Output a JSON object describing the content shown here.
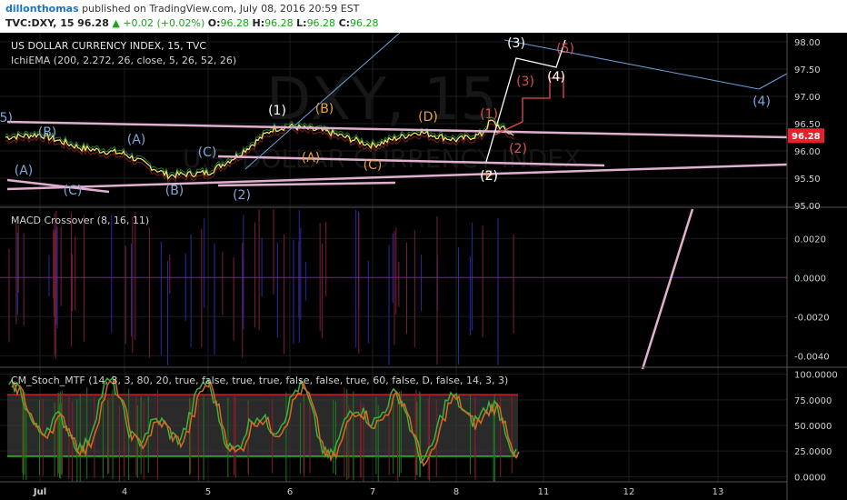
{
  "header": {
    "author": "dillonthomas",
    "published": "published on TradingView.com, July 08, 2016 20:59 EST",
    "symbol": "TVC:DXY, 15",
    "price": "96.28",
    "change": "+0.02 (+0.02%)",
    "o_label": "O:",
    "o_val": "96.28",
    "h_label": "H:",
    "h_val": "96.28",
    "l_label": "L:",
    "l_val": "96.28",
    "c_label": "C:",
    "c_val": "96.28"
  },
  "colors": {
    "background": "#000000",
    "grid": "#1c1c1c",
    "price_tag": "#e8202a",
    "macd_zero": "#7a1f7a",
    "stoch_upper": "#cc2222",
    "stoch_lower": "#22cc22",
    "trendline": "#e0b0d0",
    "channel": "#6aa0d8"
  },
  "main": {
    "title": "US DOLLAR CURRENCY INDEX, 15, TVC",
    "indicator": "IchiEMA (200, 2.272, 26, close, 5, 26, 52, 26)",
    "watermark": "DXY, 15",
    "watermark_sub": "U.S. DOLLAR CURRENCY INDEX",
    "last_price": "96.28",
    "wave_labels": [
      {
        "t": "(5)",
        "c": "#7fa7d8"
      },
      {
        "t": "(B)",
        "c": "#7fa7d8"
      },
      {
        "t": "(A)",
        "c": "#7fa7d8"
      },
      {
        "t": "(A)",
        "c": "#7fa7d8"
      },
      {
        "t": "(C)",
        "c": "#7fa7d8"
      },
      {
        "t": "(B)",
        "c": "#7fa7d8"
      },
      {
        "t": "(C)",
        "c": "#7fa7d8"
      },
      {
        "t": "(2)",
        "c": "#7fa7d8"
      },
      {
        "t": "(1)",
        "c": "#ffffff"
      },
      {
        "t": "(B)",
        "c": "#e8a040"
      },
      {
        "t": "(A)",
        "c": "#e8a040"
      },
      {
        "t": "(C)",
        "c": "#e8a040"
      },
      {
        "t": "(D)",
        "c": "#e8a040"
      },
      {
        "t": "(E)",
        "c": "#e8a040"
      },
      {
        "t": "(1)",
        "c": "#e05050"
      },
      {
        "t": "(2)",
        "c": "#e05050"
      },
      {
        "t": "(3)",
        "c": "#e05050"
      },
      {
        "t": "(4)",
        "c": "#e05050"
      },
      {
        "t": "(5)",
        "c": "#e05050"
      },
      {
        "t": "(2)",
        "c": "#ffffff"
      },
      {
        "t": "(3)",
        "c": "#ffffff"
      },
      {
        "t": "(4)",
        "c": "#ffffff"
      },
      {
        "t": "(4)",
        "c": "#7fa7d8"
      }
    ]
  },
  "macd": {
    "title": "MACD Crossover (8, 16, 11)"
  },
  "stoch": {
    "title": "CM_Stoch_MTF (14, 3, 3, 80, 20, true, false, true, true, false, false, true, 60, false, D, false, 14, 3, 3)"
  },
  "chart_data": [
    {
      "type": "line",
      "name": "price",
      "title": "US DOLLAR CURRENCY INDEX, 15, TVC",
      "x_tick_labels": [
        "Jul",
        "4",
        "5",
        "6",
        "7",
        "8",
        "11",
        "12",
        "13"
      ],
      "y_ticks": [
        98.0,
        97.5,
        97.0,
        96.5,
        96.0,
        95.5,
        95.0
      ],
      "ylim": [
        95.0,
        98.1
      ],
      "last_value": 96.28,
      "grid": true,
      "close_approx": [
        {
          "day": "Jul",
          "v": 96.3
        },
        {
          "day": "4",
          "v": 95.95
        },
        {
          "day": "5",
          "v": 95.65
        },
        {
          "day": "6",
          "v": 96.4
        },
        {
          "day": "7",
          "v": 96.1
        },
        {
          "day": "8",
          "v": 96.28
        }
      ]
    },
    {
      "type": "line",
      "title": "MACD Crossover (8, 16, 11)",
      "y_ticks": [
        0.002,
        0.0,
        -0.002,
        -0.004
      ],
      "y_tick_labels": [
        "0.0020",
        "0.0000",
        "-0.0020",
        "-0.0040"
      ],
      "ylim": [
        -0.0045,
        0.0035
      ]
    },
    {
      "type": "line",
      "title": "CM_Stoch_MTF (14, 3, 3, 80, 20, true, false, true, true, false, false, true, 60, false, D, false, 14, 3, 3)",
      "y_ticks": [
        100,
        75,
        50,
        25,
        0
      ],
      "y_tick_labels": [
        "100.0000",
        "75.0000",
        "50.0000",
        "25.0000",
        "0.0000"
      ],
      "ylim": [
        -5,
        105
      ],
      "upper_band": 80,
      "lower_band": 20
    }
  ]
}
